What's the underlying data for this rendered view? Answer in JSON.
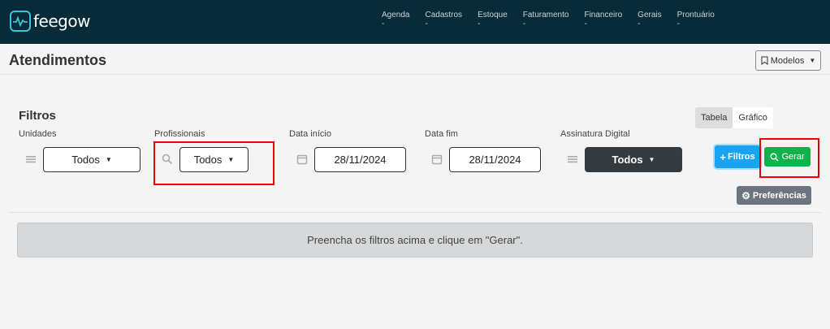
{
  "brand": {
    "name": "feegow"
  },
  "nav": {
    "items": [
      {
        "label": "Agenda",
        "caret": "-"
      },
      {
        "label": "Cadastros",
        "caret": "-"
      },
      {
        "label": "Estoque",
        "caret": "-"
      },
      {
        "label": "Faturamento",
        "caret": "-"
      },
      {
        "label": "Financeiro",
        "caret": "-"
      },
      {
        "label": "Gerais",
        "caret": "-"
      },
      {
        "label": "Prontuário",
        "caret": "-"
      }
    ]
  },
  "header": {
    "title": "Atendimentos",
    "modelos_label": "Modelos"
  },
  "filters": {
    "title": "Filtros",
    "view_tabs": [
      "Tabela",
      "Gráfico"
    ],
    "unidades": {
      "label": "Unidades",
      "value": "Todos"
    },
    "profissionais": {
      "label": "Profissionais",
      "value": "Todos"
    },
    "data_inicio": {
      "label": "Data início",
      "value": "28/11/2024"
    },
    "data_fim": {
      "label": "Data fim",
      "value": "28/11/2024"
    },
    "assinatura": {
      "label": "Assinatura Digital",
      "value": "Todos"
    },
    "filtros_button": "Filtros",
    "gerar_button": "Gerar",
    "preferencias_button": "Preferências"
  },
  "notice": "Preencha os filtros acima e clique em \"Gerar\".",
  "colors": {
    "topbar": "#082b3a",
    "accent": "#3fc1d9",
    "filtros_btn": "#1aa3f0",
    "gerar_btn": "#12b14c",
    "highlight": "#e00000"
  }
}
